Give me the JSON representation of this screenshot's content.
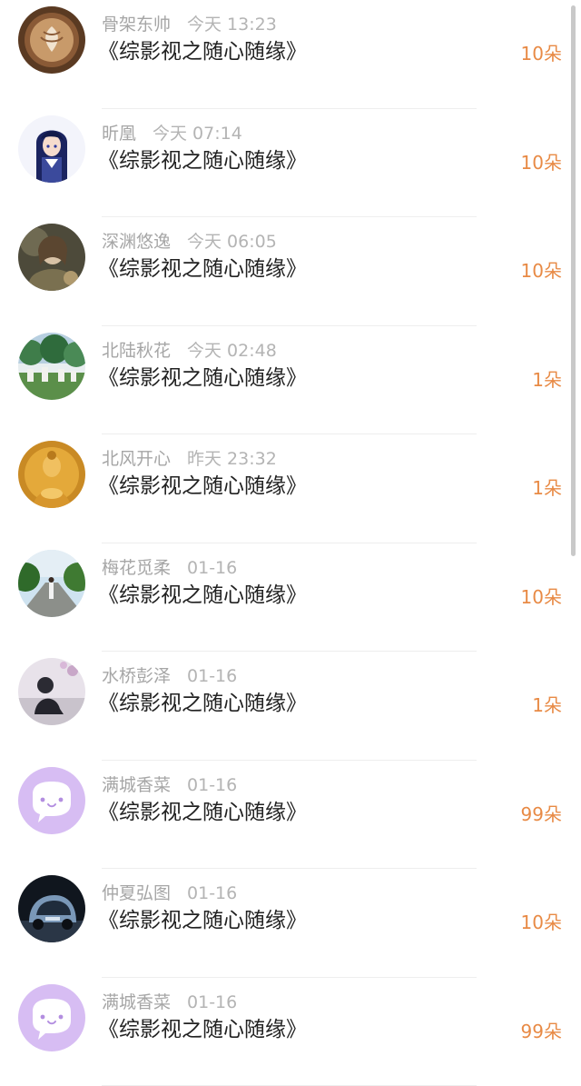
{
  "gift_list": [
    {
      "user": "骨架东帅",
      "time": "今天 13:23",
      "title": "《综影视之随心随缘》",
      "amount": "10朵",
      "avatar_icon": "latte-art-avatar-icon"
    },
    {
      "user": "昕凰",
      "time": "今天 07:14",
      "title": "《综影视之随心随缘》",
      "amount": "10朵",
      "avatar_icon": "anime-girl-avatar-icon"
    },
    {
      "user": "深渊悠逸",
      "time": "今天 06:05",
      "title": "《综影视之随心随缘》",
      "amount": "10朵",
      "avatar_icon": "blurry-girl-avatar-icon"
    },
    {
      "user": "北陆秋花",
      "time": "今天 02:48",
      "title": "《综影视之随心随缘》",
      "amount": "1朵",
      "avatar_icon": "cemetery-avatar-icon"
    },
    {
      "user": "北风开心",
      "time": "昨天 23:32",
      "title": "《综影视之随心随缘》",
      "amount": "1朵",
      "avatar_icon": "golden-buddha-avatar-icon"
    },
    {
      "user": "梅花觅柔",
      "time": "01-16",
      "title": "《综影视之随心随缘》",
      "amount": "10朵",
      "avatar_icon": "road-walker-avatar-icon"
    },
    {
      "user": "水桥彭泽",
      "time": "01-16",
      "title": "《综影视之随心随缘》",
      "amount": "1朵",
      "avatar_icon": "sitting-figure-avatar-icon"
    },
    {
      "user": "满城香菜",
      "time": "01-16",
      "title": "《综影视之随心随缘》",
      "amount": "99朵",
      "avatar_icon": "chat-bubble-avatar-icon"
    },
    {
      "user": "仲夏弘图",
      "time": "01-16",
      "title": "《综影视之随心随缘》",
      "amount": "10朵",
      "avatar_icon": "concept-car-avatar-icon"
    },
    {
      "user": "满城香菜",
      "time": "01-16",
      "title": "《综影视之随心随缘》",
      "amount": "99朵",
      "avatar_icon": "chat-bubble-avatar-icon"
    }
  ],
  "colors": {
    "amount": "#e88a45",
    "meta": "#a6a6a6",
    "title": "#222222",
    "default_avatar": "#d7bdf3"
  }
}
